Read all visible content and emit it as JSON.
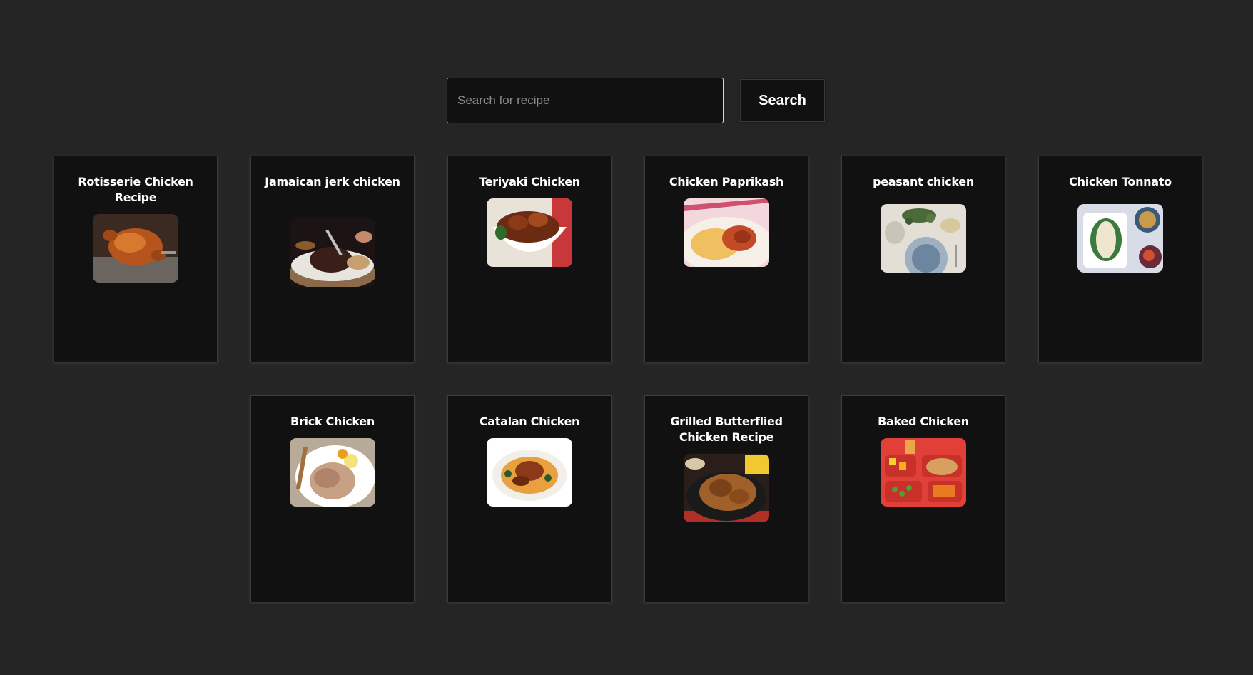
{
  "search": {
    "placeholder": "Search for recipe",
    "value": "",
    "button_label": "Search"
  },
  "recipes": [
    {
      "title": "Rotisserie Chicken Recipe",
      "image": "rotisserie-chicken-photo"
    },
    {
      "title": "Jamaican jerk chicken",
      "image": "jerk-chicken-photo"
    },
    {
      "title": "Teriyaki Chicken",
      "image": "teriyaki-chicken-photo"
    },
    {
      "title": "Chicken Paprikash",
      "image": "chicken-paprikash-photo"
    },
    {
      "title": "peasant chicken",
      "image": "peasant-chicken-photo"
    },
    {
      "title": "Chicken Tonnato",
      "image": "chicken-tonnato-photo"
    },
    {
      "title": "Brick Chicken",
      "image": "brick-chicken-photo"
    },
    {
      "title": "Catalan Chicken",
      "image": "catalan-chicken-photo"
    },
    {
      "title": "Grilled Butterflied Chicken Recipe",
      "image": "grilled-butterflied-chicken-photo"
    },
    {
      "title": "Baked Chicken",
      "image": "baked-chicken-photo"
    }
  ],
  "colors": {
    "background": "#252525",
    "card": "#111111",
    "text": "#ffffff"
  }
}
